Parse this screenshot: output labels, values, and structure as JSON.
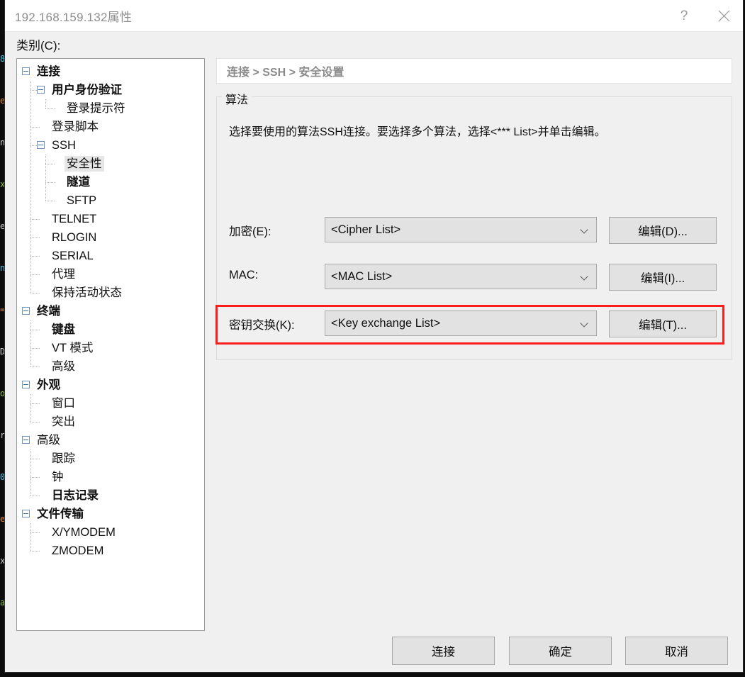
{
  "window": {
    "title": "192.168.159.132属性",
    "help_icon": "question-mark-icon",
    "close_icon": "close-icon"
  },
  "category": {
    "label": "类别(C):"
  },
  "tree": {
    "items": [
      {
        "label": "连接",
        "depth": 0,
        "bold": true,
        "expander": true,
        "selected": false
      },
      {
        "label": "用户身份验证",
        "depth": 1,
        "bold": true,
        "expander": true,
        "selected": false
      },
      {
        "label": "登录提示符",
        "depth": 2,
        "bold": false,
        "expander": false,
        "selected": false
      },
      {
        "label": "登录脚本",
        "depth": 1,
        "bold": false,
        "expander": false,
        "selected": false
      },
      {
        "label": "SSH",
        "depth": 1,
        "bold": false,
        "expander": true,
        "selected": false
      },
      {
        "label": "安全性",
        "depth": 2,
        "bold": false,
        "expander": false,
        "selected": true
      },
      {
        "label": "隧道",
        "depth": 2,
        "bold": true,
        "expander": false,
        "selected": false
      },
      {
        "label": "SFTP",
        "depth": 2,
        "bold": false,
        "expander": false,
        "selected": false
      },
      {
        "label": "TELNET",
        "depth": 1,
        "bold": false,
        "expander": false,
        "selected": false
      },
      {
        "label": "RLOGIN",
        "depth": 1,
        "bold": false,
        "expander": false,
        "selected": false
      },
      {
        "label": "SERIAL",
        "depth": 1,
        "bold": false,
        "expander": false,
        "selected": false
      },
      {
        "label": "代理",
        "depth": 1,
        "bold": false,
        "expander": false,
        "selected": false
      },
      {
        "label": "保持活动状态",
        "depth": 1,
        "bold": false,
        "expander": false,
        "selected": false
      },
      {
        "label": "终端",
        "depth": 0,
        "bold": true,
        "expander": true,
        "selected": false
      },
      {
        "label": "键盘",
        "depth": 1,
        "bold": true,
        "expander": false,
        "selected": false
      },
      {
        "label": "VT 模式",
        "depth": 1,
        "bold": false,
        "expander": false,
        "selected": false
      },
      {
        "label": "高级",
        "depth": 1,
        "bold": false,
        "expander": false,
        "selected": false
      },
      {
        "label": "外观",
        "depth": 0,
        "bold": true,
        "expander": true,
        "selected": false
      },
      {
        "label": "窗口",
        "depth": 1,
        "bold": false,
        "expander": false,
        "selected": false
      },
      {
        "label": "突出",
        "depth": 1,
        "bold": false,
        "expander": false,
        "selected": false
      },
      {
        "label": "高级",
        "depth": 0,
        "bold": false,
        "expander": true,
        "selected": false
      },
      {
        "label": "跟踪",
        "depth": 1,
        "bold": false,
        "expander": false,
        "selected": false
      },
      {
        "label": "钟",
        "depth": 1,
        "bold": false,
        "expander": false,
        "selected": false
      },
      {
        "label": "日志记录",
        "depth": 1,
        "bold": true,
        "expander": false,
        "selected": false
      },
      {
        "label": "文件传输",
        "depth": 0,
        "bold": true,
        "expander": true,
        "selected": false
      },
      {
        "label": "X/YMODEM",
        "depth": 1,
        "bold": false,
        "expander": false,
        "selected": false
      },
      {
        "label": "ZMODEM",
        "depth": 1,
        "bold": false,
        "expander": false,
        "selected": false
      }
    ]
  },
  "breadcrumb": {
    "text": "连接 > SSH > 安全设置"
  },
  "group": {
    "title": "算法",
    "description": "选择要使用的算法SSH连接。要选择多个算法，选择<*** List>并单击编辑。"
  },
  "fields": [
    {
      "label": "加密(E):",
      "value": "<Cipher List>",
      "button": "编辑(D)...",
      "name": "cipher",
      "highlighted": false
    },
    {
      "label": "MAC:",
      "value": "<MAC List>",
      "button": "编辑(I)...",
      "name": "mac",
      "highlighted": false
    },
    {
      "label": "密钥交换(K):",
      "value": "<Key exchange List>",
      "button": "编辑(T)...",
      "name": "key-exchange",
      "highlighted": true
    }
  ],
  "footer": {
    "connect": "连接",
    "ok": "确定",
    "cancel": "取消"
  },
  "colors": {
    "highlight_red": "#fa1e1e",
    "dialog_bg": "#f0f0f0",
    "control_bg": "#e2e2e2",
    "title_text": "#8d8d8d",
    "breadcrumb_text": "#8a8a8a",
    "tree_selection": "#e6e6e6"
  },
  "backdrop": {
    "lines": [
      "8",
      "e",
      "n",
      "x",
      "e",
      "n",
      "=",
      "D",
      "o",
      "r",
      "0",
      "e",
      "x",
      "a"
    ]
  }
}
